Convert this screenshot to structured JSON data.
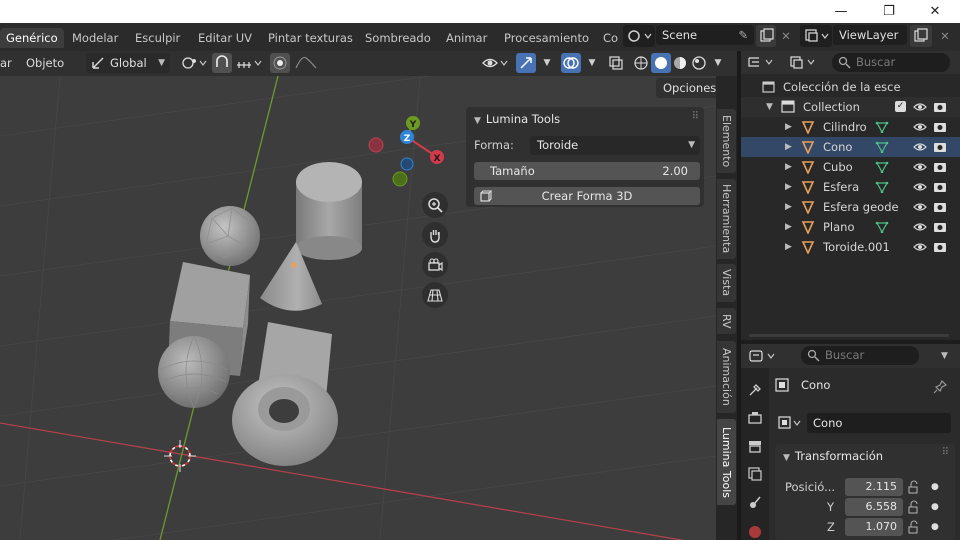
{
  "window": {
    "minimize": "—",
    "maximize": "❐",
    "close": "✕"
  },
  "workspaces": [
    "Genérico",
    "Modelar",
    "Esculpir",
    "Editar UV",
    "Pintar texturas",
    "Sombreado",
    "Animar",
    "Procesamiento",
    "Co"
  ],
  "scene": {
    "name": "Scene",
    "view_layer": "ViewLayer"
  },
  "header3d": {
    "menu_add": "ar",
    "menu_object": "Objeto",
    "orientation": "Global",
    "options": "Opciones"
  },
  "npanel": {
    "title": "Lumina Tools",
    "shape_label": "Forma:",
    "shape_value": "Toroide",
    "size_label": "Tamaño",
    "size_value": "2.00",
    "create_button": "Crear Forma 3D"
  },
  "npanel_tabs": [
    "Elemento",
    "Herramienta",
    "Vista",
    "RV",
    "Animación",
    "Lumina Tools"
  ],
  "gizmo": {
    "x": "X",
    "y": "Y",
    "z": "Z"
  },
  "outliner": {
    "search_placeholder": "Buscar",
    "scene_collection": "Colección de la esce",
    "collection": "Collection",
    "items": [
      "Cilindro",
      "Cono",
      "Cubo",
      "Esfera",
      "Esfera geode",
      "Plano",
      "Toroide.001"
    ]
  },
  "properties": {
    "search_placeholder": "Buscar",
    "object_name": "Cono",
    "data_name": "Cono",
    "section": "Transformación",
    "pos_label": "Posició...",
    "y_label": "Y",
    "z_label": "Z",
    "pos_x": "2.115",
    "pos_y": "6.558",
    "pos_z": "1.070"
  },
  "colors": {
    "accent": "#4772b3",
    "axis_x": "#d33b4c",
    "axis_y": "#6c9b22",
    "axis_z": "#2f85d6",
    "object_orange": "#e8a05a"
  }
}
